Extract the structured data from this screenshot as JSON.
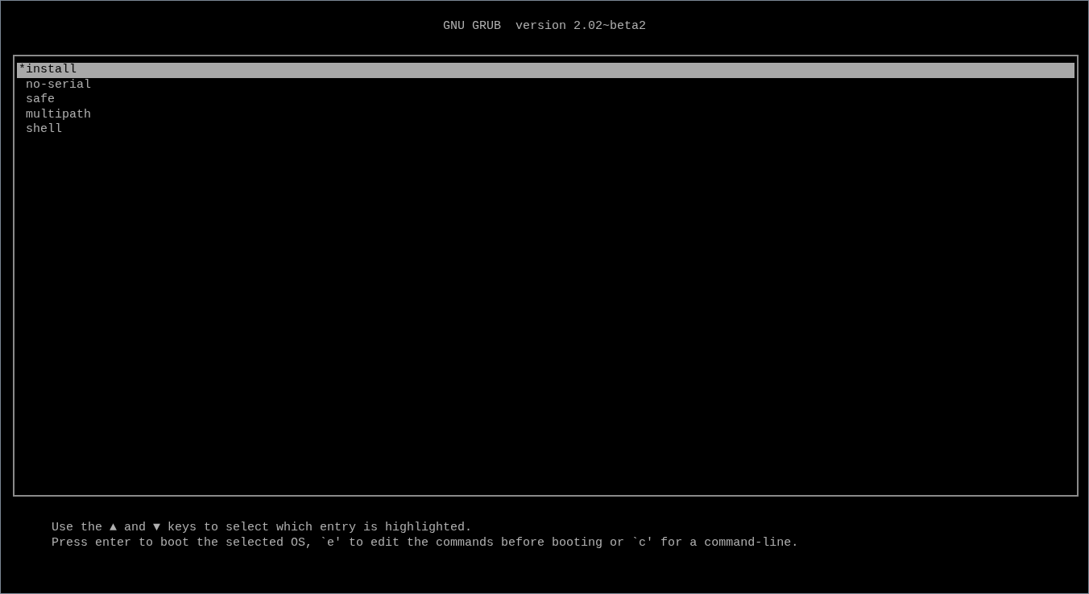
{
  "header": {
    "title": "GNU GRUB  version 2.02~beta2"
  },
  "menu": {
    "entries": [
      {
        "label": "*install",
        "selected": true
      },
      {
        "label": "no-serial",
        "selected": false
      },
      {
        "label": "safe",
        "selected": false
      },
      {
        "label": "multipath",
        "selected": false
      },
      {
        "label": "shell",
        "selected": false
      }
    ]
  },
  "help": [
    "Use the ▲ and ▼ keys to select which entry is highlighted.",
    "Press enter to boot the selected OS, `e' to edit the commands before booting or `c' for a command-line."
  ]
}
